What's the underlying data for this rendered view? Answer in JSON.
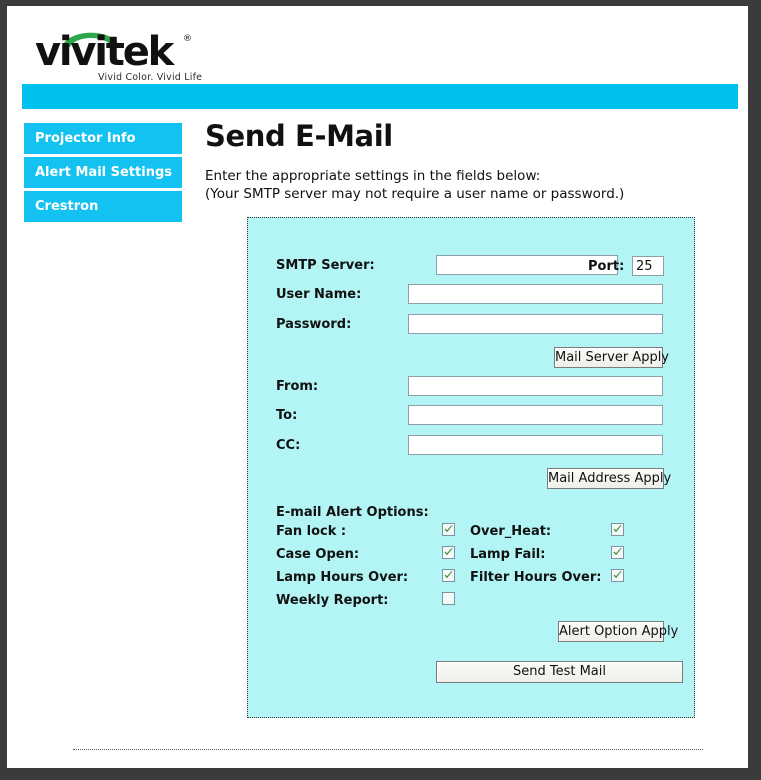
{
  "brand": {
    "wordmark": "vivitek",
    "registered_mark": "®",
    "tagline": "Vivid Color. Vivid Life",
    "arc_color": "#2aa84a",
    "banner_color": "#00c0f0"
  },
  "sidebar": {
    "items": [
      {
        "label": "Projector Info"
      },
      {
        "label": "Alert Mail Settings"
      },
      {
        "label": "Crestron"
      }
    ]
  },
  "main": {
    "title": "Send E-Mail",
    "intro_line1": "Enter the appropriate settings in the fields below:",
    "intro_line2": "(Your SMTP server may not require a user name or password.)"
  },
  "form": {
    "panel_color": "#b2f5f4",
    "server": {
      "smtp_label": "SMTP Server:",
      "smtp_value": "",
      "smtp_placeholder": "",
      "port_label": "Port:",
      "port_value": "25",
      "username_label": "User Name:",
      "username_value": "",
      "password_label": "Password:",
      "password_value": "",
      "apply_label": "Mail Server Apply"
    },
    "address": {
      "from_label": "From:",
      "from_value": "",
      "to_label": "To:",
      "to_value": "",
      "cc_label": "CC:",
      "cc_value": "",
      "apply_label": "Mail Address Apply"
    },
    "alerts": {
      "heading": "E-mail Alert Options:",
      "check_color": "#3f8f3f",
      "options": [
        {
          "label": "Fan lock :",
          "checked": true,
          "col": 0,
          "row": 0
        },
        {
          "label": "Over_Heat:",
          "checked": true,
          "col": 1,
          "row": 0
        },
        {
          "label": "Case Open:",
          "checked": true,
          "col": 0,
          "row": 1
        },
        {
          "label": "Lamp Fail:",
          "checked": true,
          "col": 1,
          "row": 1
        },
        {
          "label": "Lamp Hours Over:",
          "checked": true,
          "col": 0,
          "row": 2
        },
        {
          "label": "Filter Hours Over:",
          "checked": true,
          "col": 1,
          "row": 2
        },
        {
          "label": "Weekly Report:",
          "checked": false,
          "col": 0,
          "row": 3
        }
      ],
      "apply_label": "Alert Option Apply"
    },
    "send_test_label": "Send Test Mail"
  }
}
